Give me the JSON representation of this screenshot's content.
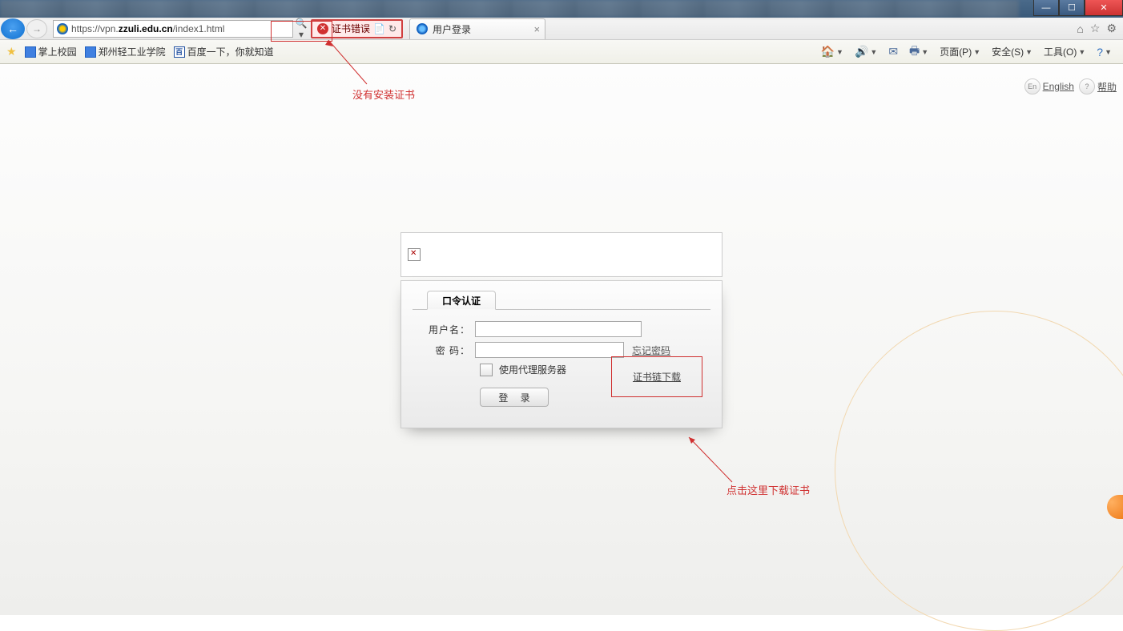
{
  "titlebar": {},
  "addr": {
    "url_prefix": "https://vpn.",
    "url_bold": "zzuli.edu.cn",
    "url_suffix": "/index1.html",
    "cert_error": "证书错误"
  },
  "tab": {
    "title": "用户登录"
  },
  "favorites": {
    "items": [
      "掌上校园",
      "郑州轻工业学院",
      "百度一下，你就知道"
    ]
  },
  "toolbar": {
    "page": "页面(P)",
    "safety": "安全(S)",
    "tools": "工具(O)"
  },
  "lang": {
    "en": "English",
    "help": "帮助"
  },
  "login": {
    "tab": "口令认证",
    "username_label": "用户名：",
    "password_label": "密  码：",
    "forgot": "忘记密码",
    "proxy": "使用代理服务器",
    "submit": "登 录",
    "cert_link": "证书链下载"
  },
  "annot": {
    "no_cert": "没有安装证书",
    "click_here": "点击这里下载证书"
  }
}
